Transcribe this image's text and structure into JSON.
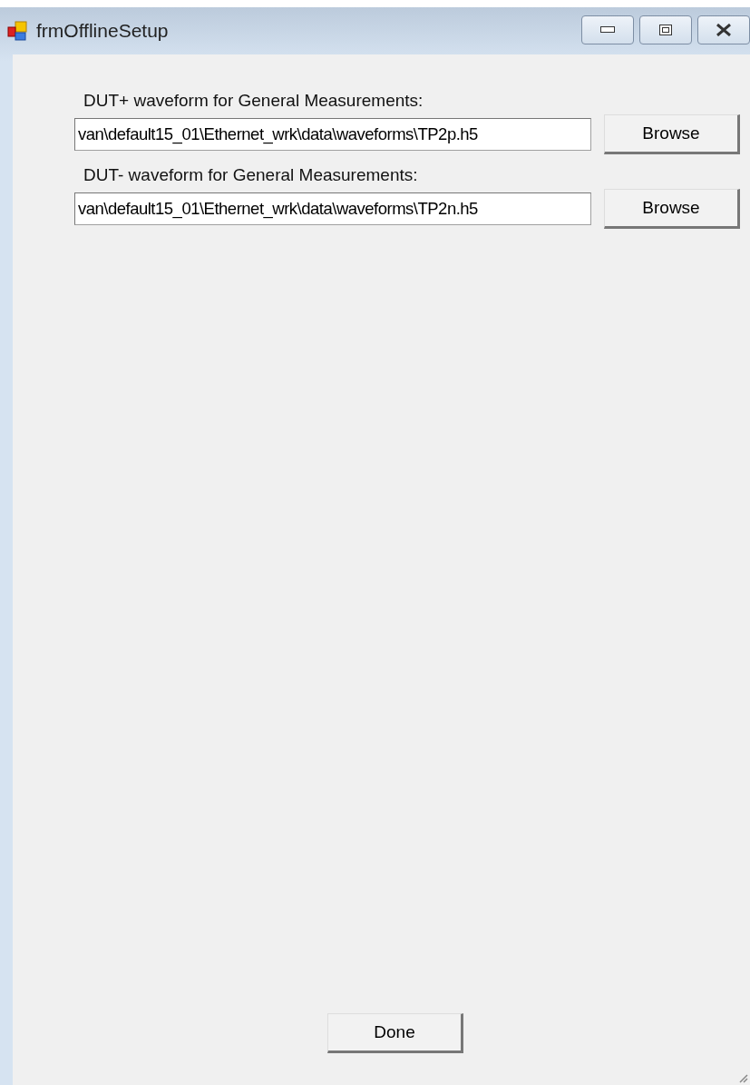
{
  "window": {
    "title": "frmOfflineSetup"
  },
  "fields": [
    {
      "label": "DUT+ waveform for General Measurements:",
      "value": "van\\default15_01\\Ethernet_wrk\\data\\waveforms\\TP2p.h5",
      "button": "Browse"
    },
    {
      "label": "DUT- waveform for General Measurements:",
      "value": "van\\default15_01\\Ethernet_wrk\\data\\waveforms\\TP2n.h5",
      "button": "Browse"
    }
  ],
  "done_button": "Done"
}
